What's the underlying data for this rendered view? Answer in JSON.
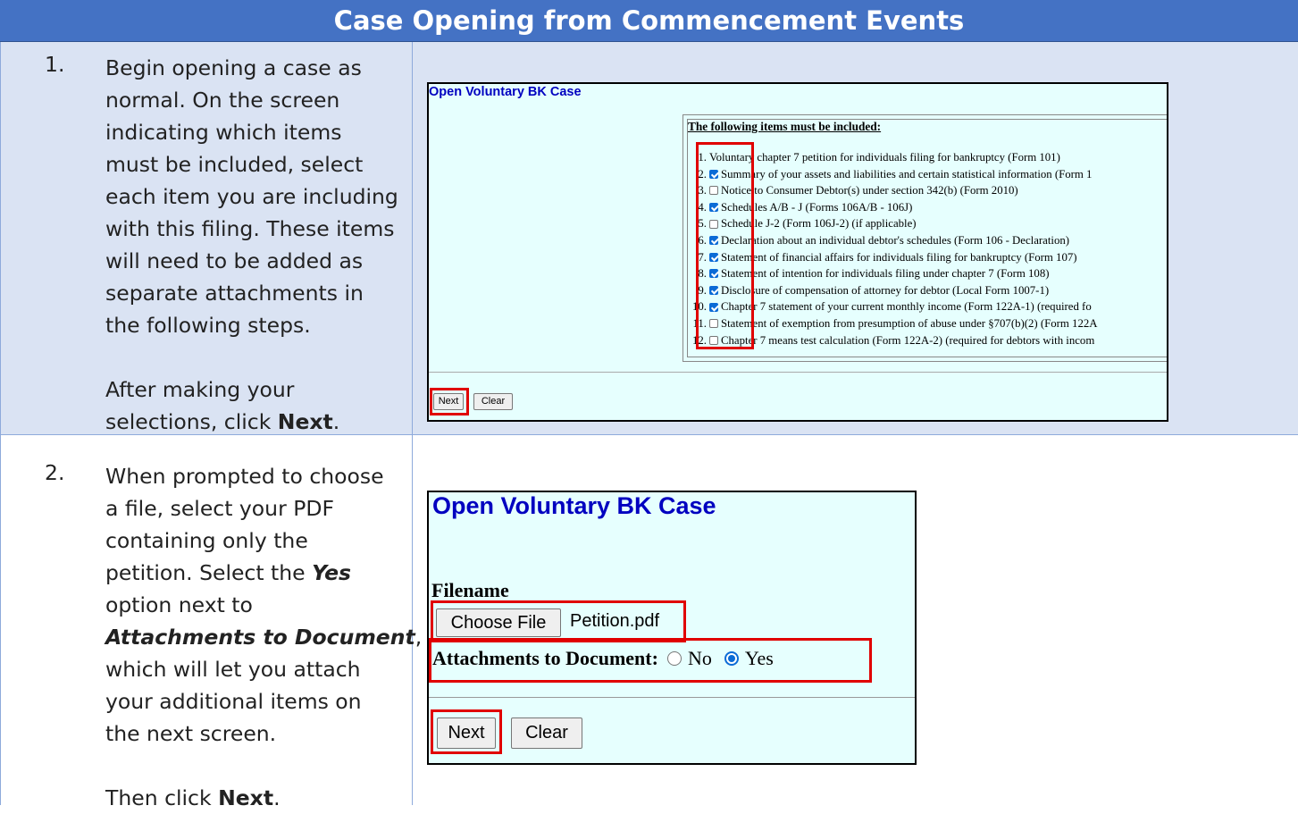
{
  "header": {
    "title": "Case Opening from Commencement Events"
  },
  "step1": {
    "number": "1.",
    "lines": [
      "Begin opening a case as",
      "normal. On the screen",
      "indicating which items",
      "must be included, select",
      "each item you are including",
      "with this filing. These items",
      "will need to be added as",
      "separate attachments in",
      "the following steps."
    ],
    "after_1": "After making your",
    "after_2_prefix": "selections, click ",
    "after_2_bold": "Next",
    "after_2_suffix": "."
  },
  "step2": {
    "number": "2.",
    "line1": "When prompted to choose",
    "line2": "a file, select your PDF",
    "line3": "containing only the",
    "line4_prefix": "petition. Select the ",
    "line4_bi": "Yes",
    "line5": "option next to",
    "line6_bi": "Attachments to Document",
    "line6_suffix": ",",
    "line7": "which will let you attach",
    "line8": "your additional items on",
    "line9": "the next screen.",
    "then_prefix": "Then click ",
    "then_bold": "Next",
    "then_suffix": "."
  },
  "screen1": {
    "title": "Open Voluntary BK Case",
    "heading": "The following items must be included:",
    "items": [
      {
        "num": "1.",
        "checkbox": false,
        "text": "Voluntary chapter 7 petition for individuals filing for bankruptcy (Form 101)"
      },
      {
        "num": "2.",
        "checkbox": true,
        "checked": true,
        "text": "Summary of your assets and liabilities and certain statistical information (Form 1"
      },
      {
        "num": "3.",
        "checkbox": true,
        "checked": false,
        "text": "Notice to Consumer Debtor(s) under section 342(b) (Form 2010)"
      },
      {
        "num": "4.",
        "checkbox": true,
        "checked": true,
        "text": "Schedules A/B - J (Forms 106A/B - 106J)"
      },
      {
        "num": "5.",
        "checkbox": true,
        "checked": false,
        "text": "Schedule J-2 (Form 106J-2) (if applicable)"
      },
      {
        "num": "6.",
        "checkbox": true,
        "checked": true,
        "text": "Declaration about an individual debtor's schedules (Form 106 - Declaration)"
      },
      {
        "num": "7.",
        "checkbox": true,
        "checked": true,
        "text": "Statement of financial affairs for individuals filing for bankruptcy (Form 107)"
      },
      {
        "num": "8.",
        "checkbox": true,
        "checked": true,
        "text": "Statement of intention for individuals filing under chapter 7 (Form 108)"
      },
      {
        "num": "9.",
        "checkbox": true,
        "checked": true,
        "text": "Disclosure of compensation of attorney for debtor (Local Form 1007-1)"
      },
      {
        "num": "10.",
        "checkbox": true,
        "checked": true,
        "text": "Chapter 7 statement of your current monthly income (Form 122A-1) (required fo"
      },
      {
        "num": "11.",
        "checkbox": true,
        "checked": false,
        "text": "Statement of exemption from presumption of abuse under §707(b)(2) (Form 122A"
      },
      {
        "num": "12.",
        "checkbox": true,
        "checked": false,
        "text": "Chapter 7 means test calculation (Form 122A-2) (required for debtors with incom"
      }
    ],
    "next_label": "Next",
    "clear_label": "Clear"
  },
  "screen2": {
    "title": "Open Voluntary BK Case",
    "filename_label": "Filename",
    "choose_file_label": "Choose File",
    "file_name": "Petition.pdf",
    "attach_label": "Attachments to Document:",
    "no_label": "No",
    "yes_label": "Yes",
    "selected": "Yes",
    "next_label": "Next",
    "clear_label": "Clear"
  },
  "colors": {
    "header": "#4472c4",
    "row_shade": "#dae3f3",
    "screen_bg": "#e6fffe",
    "highlight": "#e00000",
    "title_blue": "#0000c0"
  }
}
